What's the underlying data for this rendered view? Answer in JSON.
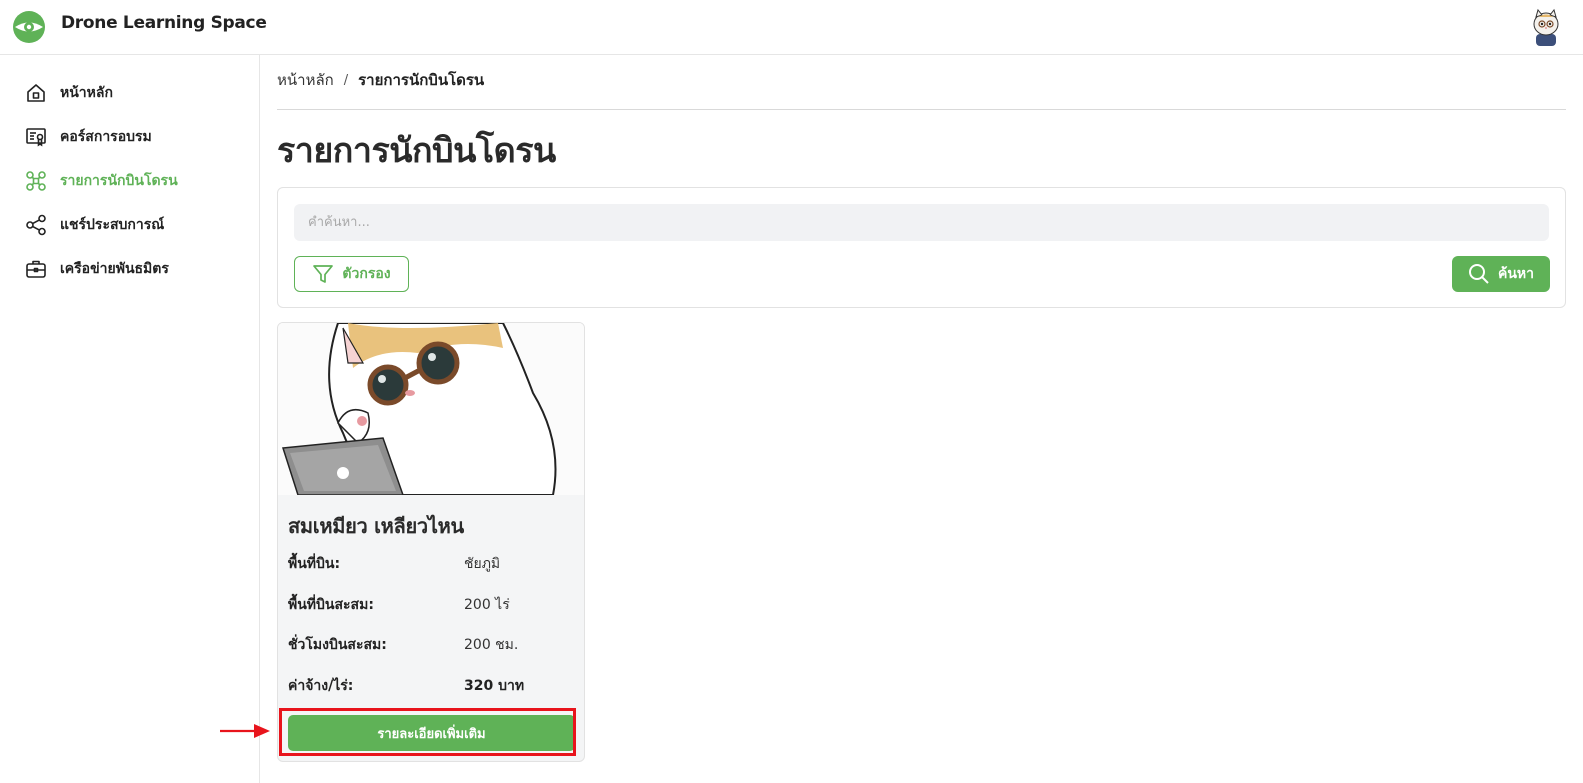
{
  "app": {
    "title": "Drone Learning Space"
  },
  "sidebar": {
    "items": [
      {
        "label": "หน้าหลัก",
        "icon": "home-icon",
        "active": false
      },
      {
        "label": "คอร์สการอบรม",
        "icon": "certificate-icon",
        "active": false
      },
      {
        "label": "รายการนักบินโดรน",
        "icon": "drone-icon",
        "active": true
      },
      {
        "label": "แชร์ประสบการณ์",
        "icon": "share-icon",
        "active": false
      },
      {
        "label": "เครือข่ายพันธมิตร",
        "icon": "briefcase-icon",
        "active": false
      }
    ]
  },
  "breadcrumb": {
    "home": "หน้าหลัก",
    "separator": "/",
    "current": "รายการนักบินโดรน"
  },
  "page": {
    "title": "รายการนักบินโดรน"
  },
  "search": {
    "placeholder": "คำค้นหา...",
    "value": "",
    "filter_label": "ตัวกรอง",
    "search_label": "ค้นหา"
  },
  "pilot_card": {
    "name": "สมเหมียว เหลียวไหน",
    "fields": [
      {
        "key": "พื้นที่บิน:",
        "value": "ชัยภูมิ"
      },
      {
        "key": "พื้นที่บินสะสม:",
        "value": "200 ไร่"
      },
      {
        "key": "ชั่วโมงบินสะสม:",
        "value": "200 ชม."
      },
      {
        "key": "ค่าจ้าง/ไร่:",
        "value": "320 บาท"
      }
    ],
    "detail_button": "รายละเอียดเพิ่มเติม"
  },
  "colors": {
    "accent": "#5fb257",
    "highlight": "#e8141c"
  }
}
